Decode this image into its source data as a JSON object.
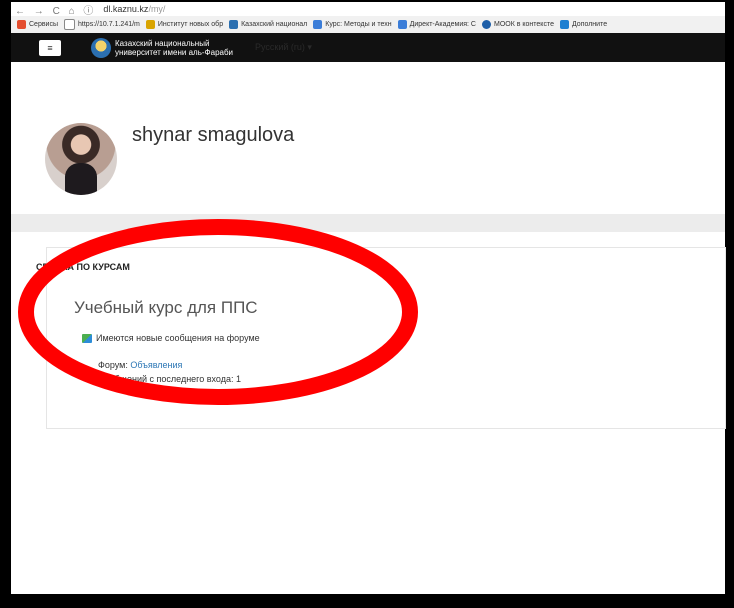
{
  "browser": {
    "url_host": "dl.kaznu.kz",
    "url_path": "/my/",
    "bookmarks": [
      {
        "label": "Сервисы",
        "color": "#e44d2e"
      },
      {
        "label": "https://10.7.1.241/m",
        "color": "#888888"
      },
      {
        "label": "Институт новых обр",
        "color": "#d9a400"
      },
      {
        "label": "Казахский национал",
        "color": "#2b6fb0"
      },
      {
        "label": "Курс: Методы и техн",
        "color": "#3b7dd8"
      },
      {
        "label": "Директ-Академия: С",
        "color": "#3b7dd8"
      },
      {
        "label": "МООК в контексте",
        "color": "#1e5fa8"
      },
      {
        "label": "Дополните",
        "color": "#1e7fd1"
      }
    ]
  },
  "navbar": {
    "menu_icon": "hamburger-icon",
    "university_line1": "Казахский национальный",
    "university_line2": "университет имени аль-Фараби",
    "language": "Русский (ru) ▾"
  },
  "profile": {
    "name": "shynar smagulova"
  },
  "course_overview": {
    "title": "СВОДКА ПО КУРСАМ",
    "course_name": "Учебный курс для ППС",
    "notice": "Имеются новые сообщения на форуме",
    "forum_label": "Форум:",
    "forum_link": "Объявления",
    "posts_text": "Сообщений с последнего входа: 1"
  },
  "annotation": {
    "ellipse_color": "#ff0000"
  }
}
